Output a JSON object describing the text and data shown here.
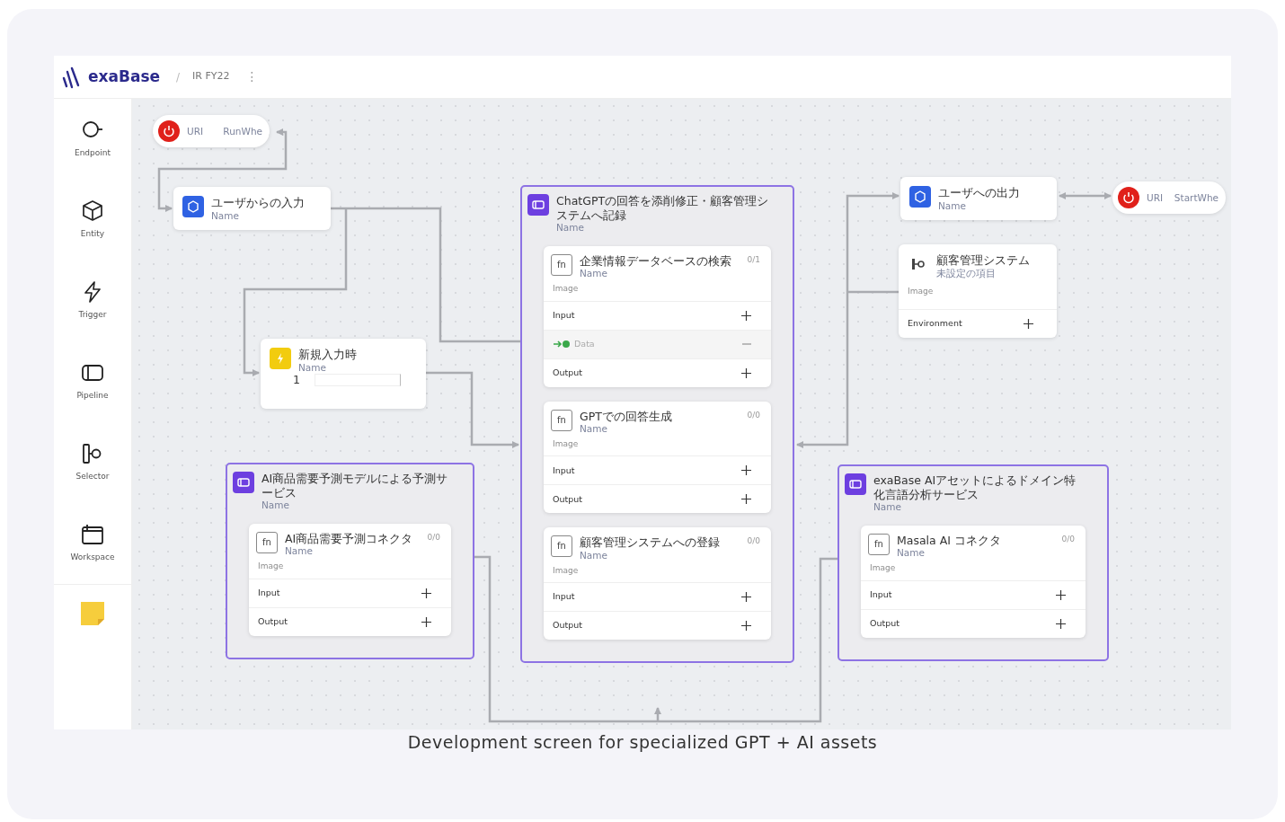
{
  "header": {
    "logo": "exaBase",
    "separator": "/",
    "project": "IR FY22",
    "menu": "⋮"
  },
  "sidebar": {
    "items": [
      {
        "kind": "endpoint",
        "label": "Endpoint"
      },
      {
        "kind": "entity",
        "label": "Entity"
      },
      {
        "kind": "trigger",
        "label": "Trigger"
      },
      {
        "kind": "pipeline",
        "label": "Pipeline"
      },
      {
        "kind": "selector",
        "label": "Selector"
      },
      {
        "kind": "workspace",
        "label": "Workspace"
      }
    ]
  },
  "nodes": [
    {
      "kind": "endpoint",
      "type_label": "URI",
      "trigger_label": "RunWhe"
    },
    {
      "kind": "entity",
      "title": "ユーザからの入力",
      "subtitle": "Name"
    },
    {
      "kind": "trigger",
      "title": "新規入力時",
      "subtitle": "Name",
      "number": "1"
    },
    {
      "kind": "pipeline",
      "title": "ChatGPTの回答を添削修正・顧客管理システムへ記録",
      "subtitle": "Name",
      "functions": [
        {
          "icon_text": "fn",
          "title": "企業情報データベースの検索",
          "subtitle": "Name",
          "count": "0/1",
          "image_label": "Image",
          "rows": [
            {
              "kind": "port",
              "label": "Input"
            },
            {
              "kind": "data",
              "label": "Data"
            },
            {
              "kind": "port",
              "label": "Output"
            }
          ]
        },
        {
          "icon_text": "fn",
          "title": "GPTでの回答生成",
          "subtitle": "Name",
          "count": "0/0",
          "image_label": "Image",
          "rows": [
            {
              "kind": "port",
              "label": "Input"
            },
            {
              "kind": "port",
              "label": "Output"
            }
          ]
        },
        {
          "icon_text": "fn",
          "title": "顧客管理システムへの登録",
          "subtitle": "Name",
          "count": "0/0",
          "image_label": "Image",
          "rows": [
            {
              "kind": "port",
              "label": "Input"
            },
            {
              "kind": "port",
              "label": "Output"
            }
          ]
        }
      ]
    },
    {
      "kind": "entity",
      "title": "ユーザへの出力",
      "subtitle": "Name"
    },
    {
      "kind": "endpoint",
      "type_label": "URI",
      "trigger_label": "StartWhe"
    },
    {
      "kind": "selector",
      "title": "顧客管理システム",
      "subtitle": "未設定の項目",
      "image_label": "Image",
      "rows": [
        {
          "kind": "port",
          "label": "Environment"
        }
      ]
    },
    {
      "kind": "pipeline",
      "title": "AI商品需要予測モデルによる予測サービス",
      "subtitle": "Name",
      "functions": [
        {
          "icon_text": "fn",
          "title": "AI商品需要予測コネクタ",
          "subtitle": "Name",
          "count": "0/0",
          "image_label": "Image",
          "rows": [
            {
              "kind": "port",
              "label": "Input"
            },
            {
              "kind": "port",
              "label": "Output"
            }
          ]
        }
      ]
    },
    {
      "kind": "pipeline",
      "title": "exaBase AIアセットによるドメイン特化言語分析サービス",
      "subtitle": "Name",
      "functions": [
        {
          "icon_text": "fn",
          "title": "Masala AI コネクタ",
          "subtitle": "Name",
          "count": "0/0",
          "image_label": "Image",
          "rows": [
            {
              "kind": "port",
              "label": "Input"
            },
            {
              "kind": "port",
              "label": "Output"
            }
          ]
        }
      ]
    }
  ],
  "caption": "Development screen for specialized GPT + AI assets"
}
